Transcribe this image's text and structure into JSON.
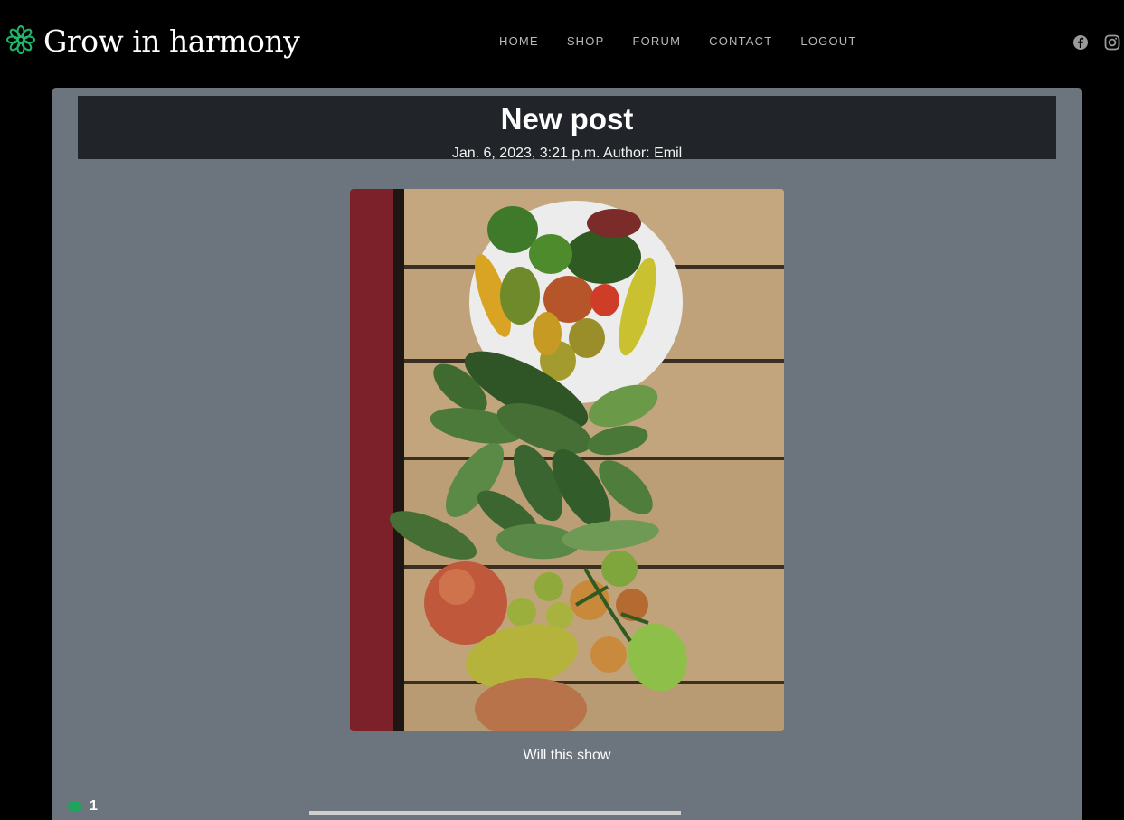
{
  "brand": {
    "name": "Grow in harmony",
    "logo_icon": "flower-icon",
    "logo_color": "#1fb86b"
  },
  "nav": {
    "items": [
      "HOME",
      "SHOP",
      "FORUM",
      "CONTACT",
      "LOGOUT"
    ]
  },
  "social": {
    "icons": [
      "facebook-icon",
      "instagram-icon"
    ]
  },
  "post": {
    "title": "New post",
    "meta": "Jan. 6, 2023, 3:21 p.m. Author: Emil",
    "image_description_icon": "vegetable-photo",
    "caption": "Will this show",
    "likes": "1",
    "like_icon": "heart-icon"
  },
  "colors": {
    "background": "#000000",
    "card": "#6c757d",
    "title_box": "#212529",
    "accent": "#20a35c"
  }
}
